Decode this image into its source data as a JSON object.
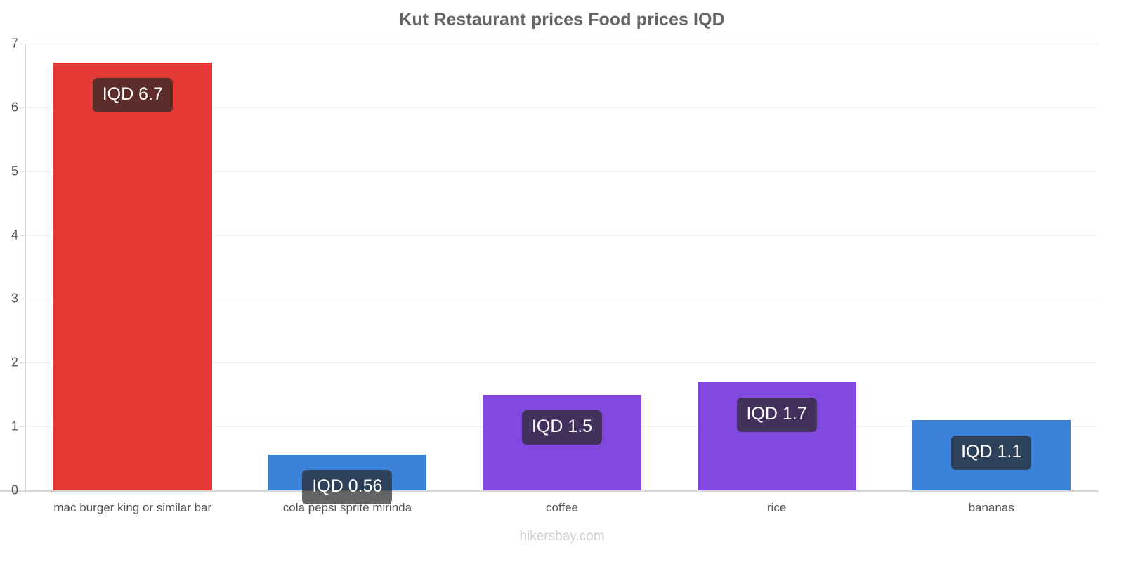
{
  "chart_data": {
    "type": "bar",
    "title": "Kut Restaurant prices Food prices IQD",
    "xlabel": "",
    "ylabel": "",
    "ylim": [
      0,
      7
    ],
    "yticks": [
      0,
      1,
      2,
      3,
      4,
      5,
      6,
      7
    ],
    "ytick_labels": [
      "0",
      "1",
      "2",
      "3",
      "4",
      "5",
      "6",
      "7"
    ],
    "grid": true,
    "legend": false,
    "currency": "IQD",
    "categories": [
      "mac burger king or similar bar",
      "cola pepsi sprite mirinda",
      "coffee",
      "rice",
      "bananas"
    ],
    "values": [
      6.7,
      0.56,
      1.5,
      1.7,
      1.1
    ],
    "data_labels": [
      "IQD 6.7",
      "IQD 0.56",
      "IQD 1.5",
      "IQD 1.7",
      "IQD 1.1"
    ],
    "bar_colors": [
      "#e53935",
      "#3b82da",
      "#8348e0",
      "#8348e0",
      "#3b82da"
    ],
    "title_color": "#666666",
    "axis_color": "#d6d6d6",
    "tick_label_color": "#555555",
    "grid_color": "#f2f2f2",
    "badge_color": "#282828",
    "badge_text_color": "#ffffff"
  },
  "footer": {
    "credit": "hikersbay.com",
    "credit_color": "#cfcfd4"
  }
}
